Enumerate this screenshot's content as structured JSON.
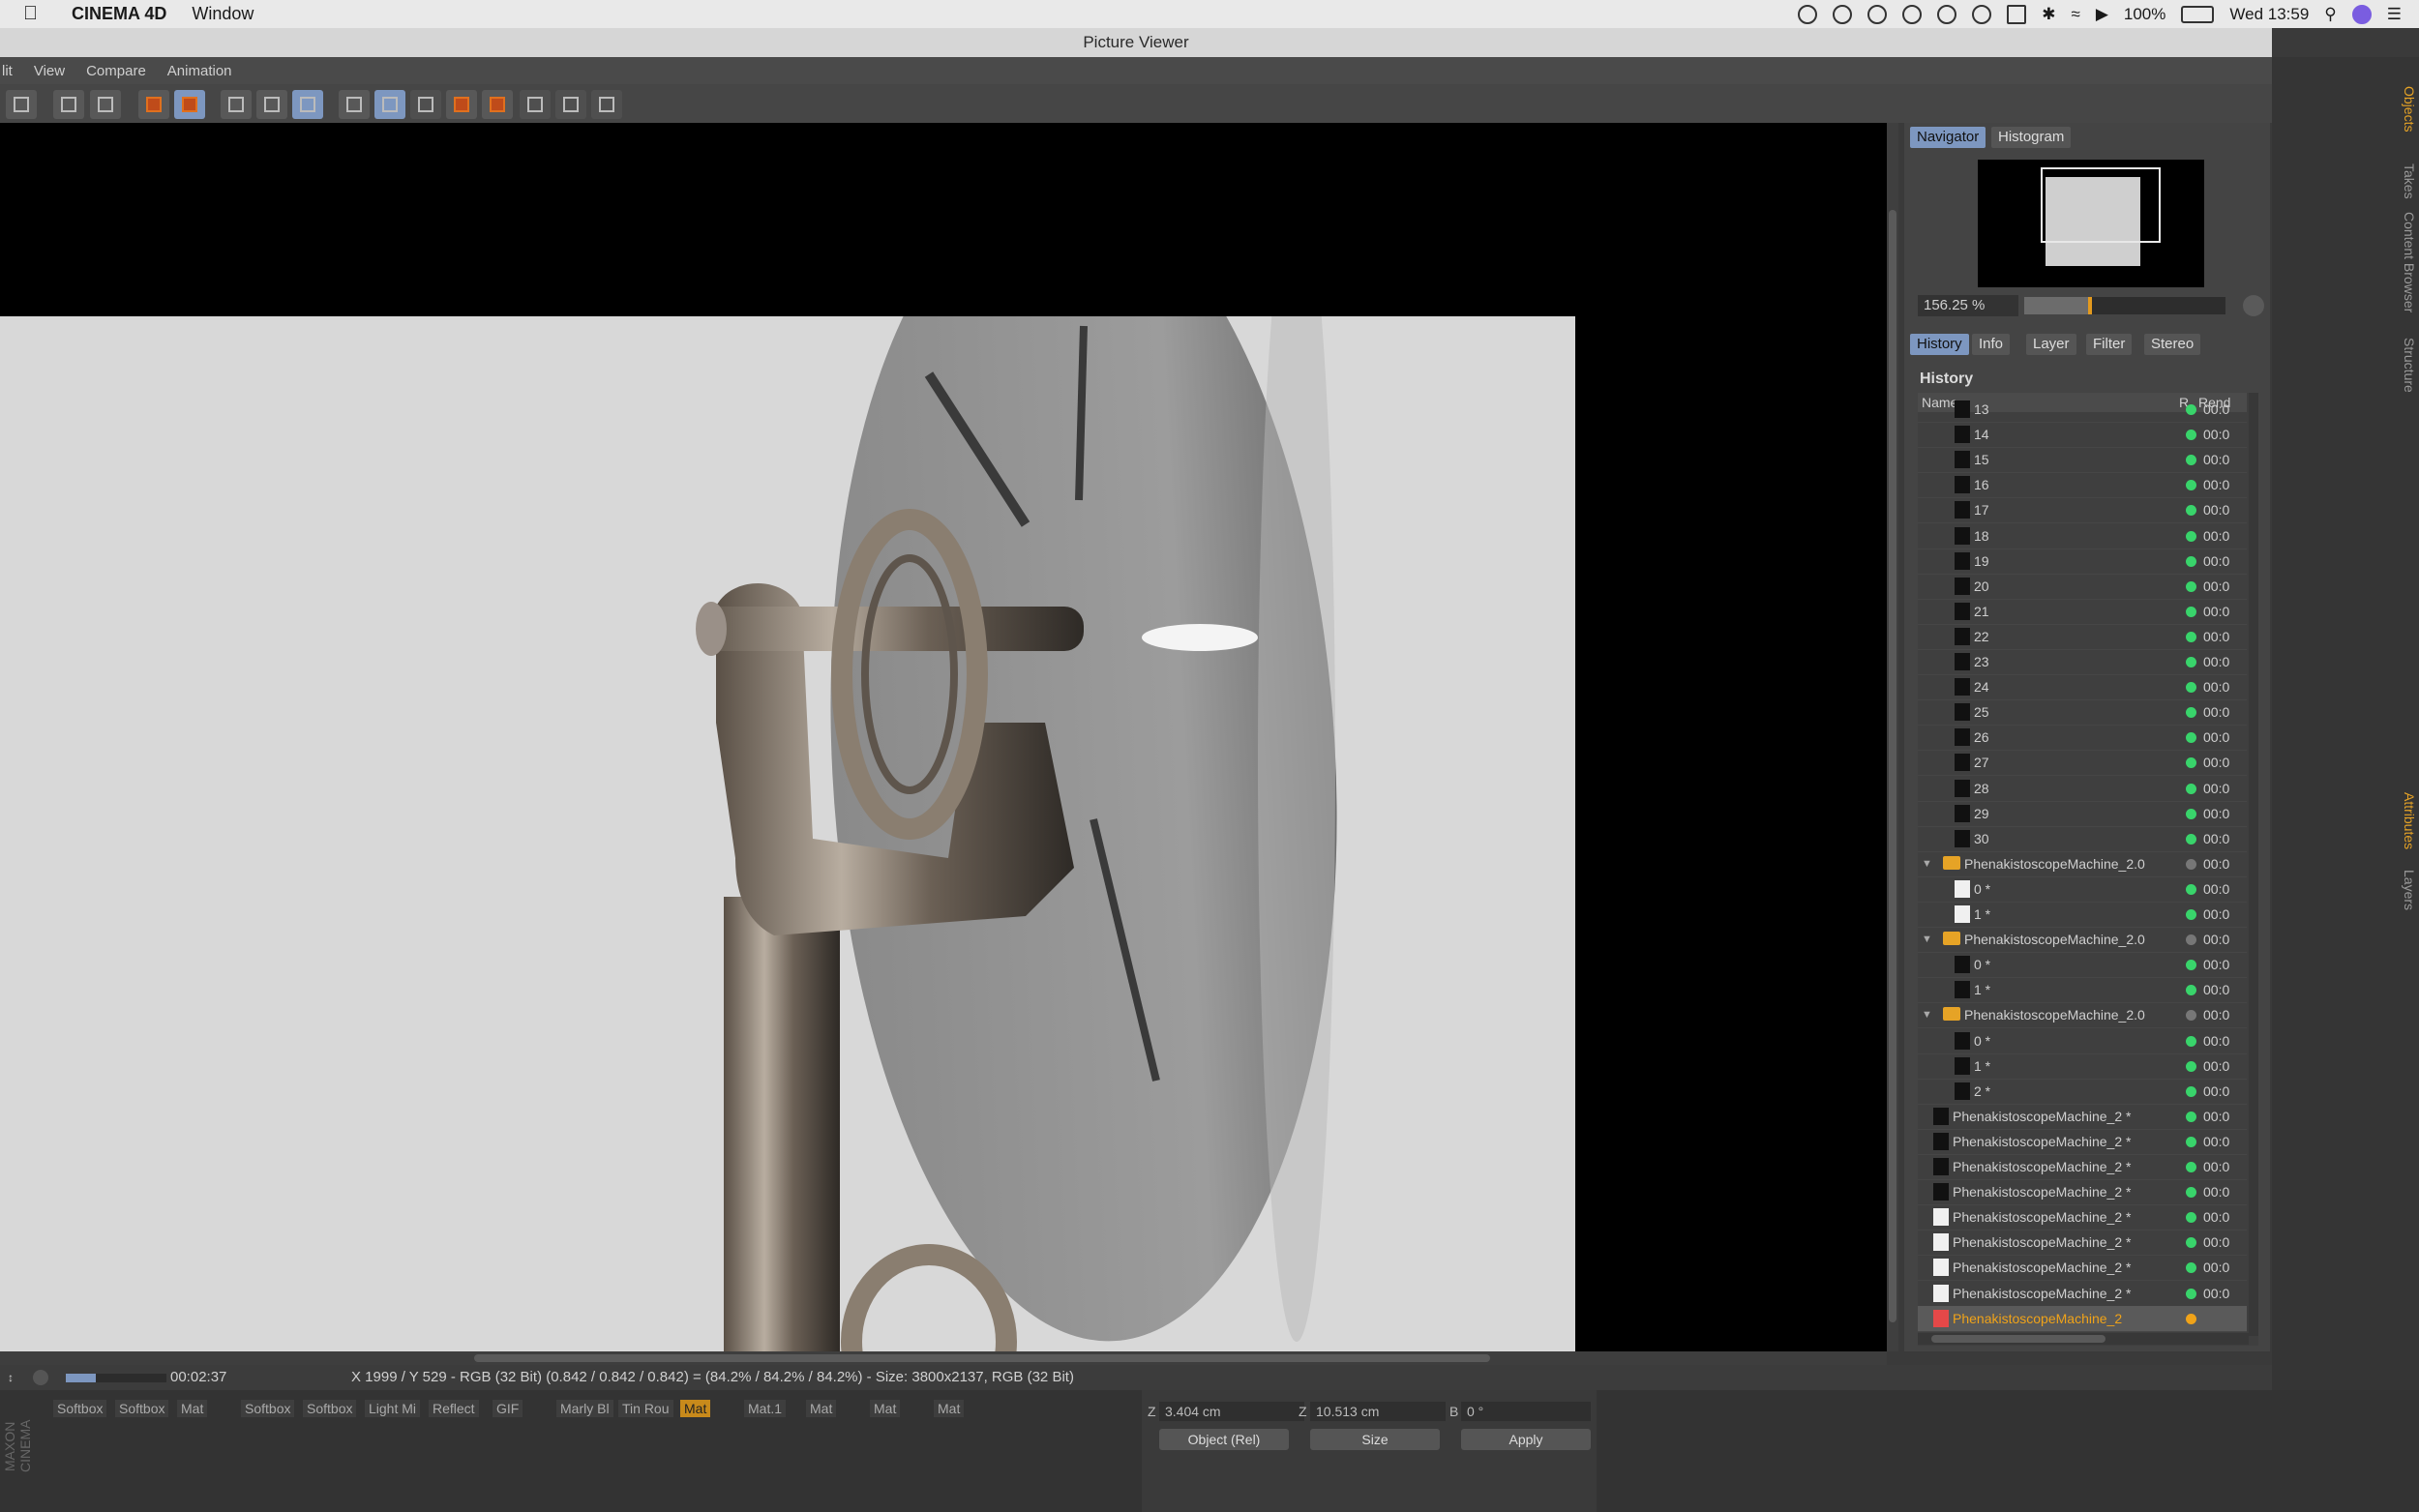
{
  "menubar": {
    "app": "CINEMA 4D",
    "items": [
      "Window"
    ],
    "battery": "100%",
    "clock": "Wed 13:59"
  },
  "window": {
    "title": "Picture Viewer",
    "menu": [
      "lit",
      "View",
      "Compare",
      "Animation"
    ]
  },
  "panel": {
    "top_tabs": [
      "Navigator",
      "Histogram"
    ],
    "zoom": "156.25 %",
    "tabs": [
      "History",
      "Info",
      "Layer",
      "Filter",
      "Stereo"
    ],
    "history_title": "History",
    "columns": {
      "name": "Name",
      "r": "R",
      "rend": "Rend"
    },
    "rows": [
      {
        "name": "13",
        "thumb": "dark",
        "dot": "green",
        "time": "00:0"
      },
      {
        "name": "14",
        "thumb": "dark",
        "dot": "green",
        "time": "00:0"
      },
      {
        "name": "15",
        "thumb": "dark",
        "dot": "green",
        "time": "00:0"
      },
      {
        "name": "16",
        "thumb": "dark",
        "dot": "green",
        "time": "00:0"
      },
      {
        "name": "17",
        "thumb": "dark",
        "dot": "green",
        "time": "00:0"
      },
      {
        "name": "18",
        "thumb": "dark",
        "dot": "green",
        "time": "00:0"
      },
      {
        "name": "19",
        "thumb": "dark",
        "dot": "green",
        "time": "00:0"
      },
      {
        "name": "20",
        "thumb": "dark",
        "dot": "green",
        "time": "00:0"
      },
      {
        "name": "21",
        "thumb": "dark",
        "dot": "green",
        "time": "00:0"
      },
      {
        "name": "22",
        "thumb": "dark",
        "dot": "green",
        "time": "00:0"
      },
      {
        "name": "23",
        "thumb": "dark",
        "dot": "green",
        "time": "00:0"
      },
      {
        "name": "24",
        "thumb": "dark",
        "dot": "green",
        "time": "00:0"
      },
      {
        "name": "25",
        "thumb": "dark",
        "dot": "green",
        "time": "00:0"
      },
      {
        "name": "26",
        "thumb": "dark",
        "dot": "green",
        "time": "00:0"
      },
      {
        "name": "27",
        "thumb": "dark",
        "dot": "green",
        "time": "00:0"
      },
      {
        "name": "28",
        "thumb": "dark",
        "dot": "green",
        "time": "00:0"
      },
      {
        "name": "29",
        "thumb": "dark",
        "dot": "green",
        "time": "00:0"
      },
      {
        "name": "30",
        "thumb": "dark",
        "dot": "green",
        "time": "00:0"
      },
      {
        "name": "PhenakistoscopeMachine_2.0",
        "folder": true,
        "dot": "grey",
        "time": "00:0"
      },
      {
        "name": "0 *",
        "thumb": "light",
        "dot": "green",
        "time": "00:0"
      },
      {
        "name": "1 *",
        "thumb": "light",
        "dot": "green",
        "time": "00:0"
      },
      {
        "name": "PhenakistoscopeMachine_2.0",
        "folder": true,
        "dot": "grey",
        "time": "00:0"
      },
      {
        "name": "0 *",
        "thumb": "dark",
        "dot": "green",
        "time": "00:0"
      },
      {
        "name": "1 *",
        "thumb": "dark",
        "dot": "green",
        "time": "00:0"
      },
      {
        "name": "PhenakistoscopeMachine_2.0",
        "folder": true,
        "dot": "grey",
        "time": "00:0"
      },
      {
        "name": "0 *",
        "thumb": "dark",
        "dot": "green",
        "time": "00:0"
      },
      {
        "name": "1 *",
        "thumb": "dark",
        "dot": "green",
        "time": "00:0"
      },
      {
        "name": "2 *",
        "thumb": "dark",
        "dot": "green",
        "time": "00:0"
      },
      {
        "name": "PhenakistoscopeMachine_2 *",
        "thumb": "dark",
        "dot": "green",
        "time": "00:0",
        "top": true
      },
      {
        "name": "PhenakistoscopeMachine_2 *",
        "thumb": "dark",
        "dot": "green",
        "time": "00:0",
        "top": true
      },
      {
        "name": "PhenakistoscopeMachine_2 *",
        "thumb": "dark",
        "dot": "green",
        "time": "00:0",
        "top": true
      },
      {
        "name": "PhenakistoscopeMachine_2 *",
        "thumb": "dark",
        "dot": "green",
        "time": "00:0",
        "top": true
      },
      {
        "name": "PhenakistoscopeMachine_2 *",
        "thumb": "light",
        "dot": "green",
        "time": "00:0",
        "top": true
      },
      {
        "name": "PhenakistoscopeMachine_2 *",
        "thumb": "light",
        "dot": "green",
        "time": "00:0",
        "top": true
      },
      {
        "name": "PhenakistoscopeMachine_2 *",
        "thumb": "light",
        "dot": "green",
        "time": "00:0",
        "top": true
      },
      {
        "name": "PhenakistoscopeMachine_2 *",
        "thumb": "light",
        "dot": "green",
        "time": "00:0",
        "top": true
      },
      {
        "name": "PhenakistoscopeMachine_2",
        "thumb": "red",
        "dot": "orange",
        "time": "",
        "top": true,
        "selected": true
      }
    ]
  },
  "status": {
    "time": "00:02:37",
    "progress": 0.3,
    "info": "X 1999 / Y 529 - RGB (32 Bit) (0.842 / 0.842 / 0.842) = (84.2% / 84.2% / 84.2%) - Size: 3800x2137, RGB (32 Bit)"
  },
  "materials": [
    "Softbox",
    "Softbox",
    "Mat",
    "Softbox",
    "Softbox",
    "Light Mi",
    "Reflect",
    "GIF",
    "Marly Bl",
    "Tin Rou",
    "Mat",
    "Mat.1",
    "Mat",
    "Mat",
    "Mat"
  ],
  "material_selected": 10,
  "coords": {
    "z_label": "Z",
    "z_value": "3.404 cm",
    "z2_label": "Z",
    "z2_value": "10.513 cm",
    "b_label": "B",
    "b_value": "0 °",
    "mode": "Object (Rel)",
    "size_mode": "Size",
    "apply": "Apply"
  },
  "logo": "MAXON CINEMA",
  "side_tabs": [
    "Objects",
    "Takes",
    "Content Browser",
    "Structure",
    "Attributes",
    "Layers"
  ],
  "colors": {
    "accent": "#7d97c0",
    "active": "#e6a326",
    "ok": "#39d46b"
  }
}
